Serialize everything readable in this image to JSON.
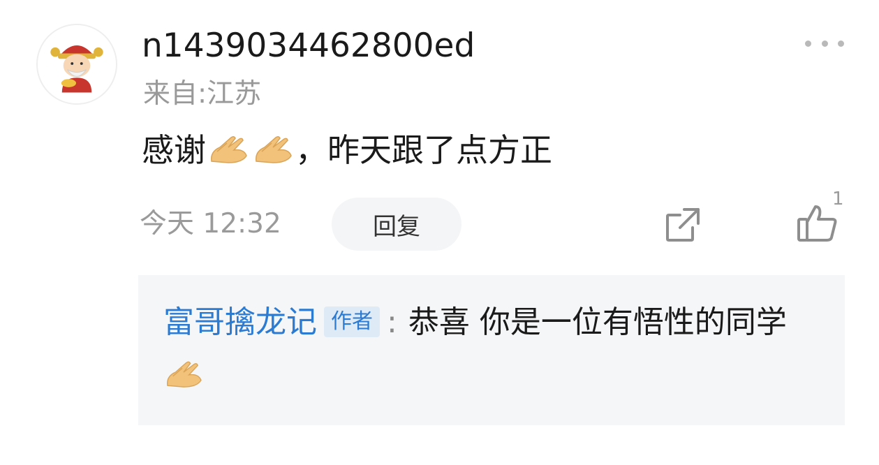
{
  "comment": {
    "username": "n1439034462800ed",
    "location": "来自:江苏",
    "text_part1": "感谢",
    "text_part2": "，昨天跟了点方正",
    "time": "今天 12:32",
    "reply_label": "回复",
    "like_count": "1",
    "emojis": [
      "folded-hands-emoji",
      "folded-hands-emoji"
    ]
  },
  "sub_reply": {
    "author": "富哥擒龙记",
    "badge": "作者",
    "colon": ":",
    "text": "恭喜 你是一位有悟性的同学",
    "emoji": "folded-hands-emoji"
  },
  "icons": {
    "more": "more-dots-icon",
    "share": "share-icon",
    "like": "thumbs-up-icon",
    "avatar": "god-of-wealth-avatar"
  },
  "colors": {
    "author_link": "#2b7bd3",
    "muted_text": "#999999",
    "sub_reply_bg": "#f5f6f8"
  }
}
